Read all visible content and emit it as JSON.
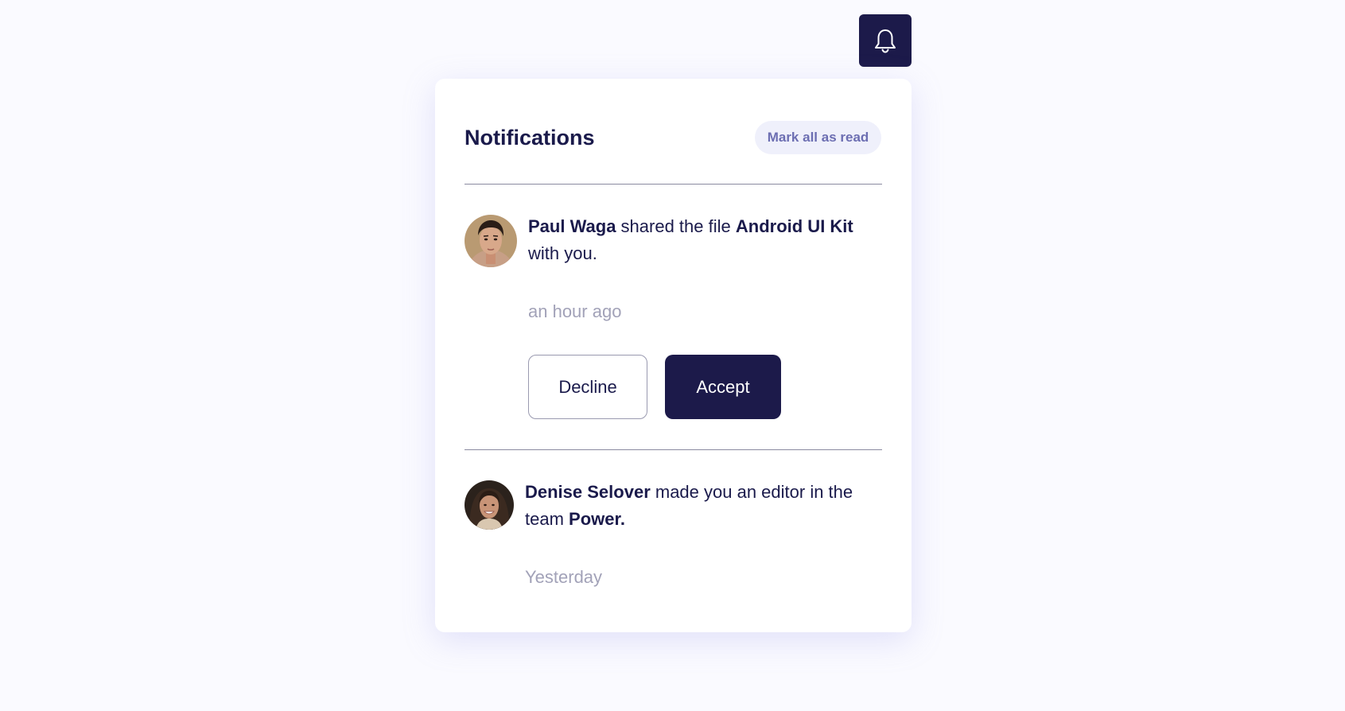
{
  "bell": {
    "icon": "bell-icon"
  },
  "panel": {
    "title": "Notifications",
    "mark_all_label": "Mark all as read"
  },
  "notifications": [
    {
      "actor": "Paul Waga",
      "action": " shared the file ",
      "object": "Android UI Kit",
      "suffix": " with you.",
      "time": "an hour ago",
      "decline_label": "Decline",
      "accept_label": "Accept"
    },
    {
      "actor": "Denise Selover",
      "action": " made you an editor in the team ",
      "object": "Power.",
      "suffix": "",
      "time": "Yesterday"
    }
  ],
  "colors": {
    "page_bg": "#fafaff",
    "panel_bg": "#ffffff",
    "primary_dark": "#1c1a4a",
    "text": "#1a1a4b",
    "muted": "#a2a2b8",
    "chip_bg": "#eff0fb",
    "chip_text": "#6c6eb2"
  }
}
